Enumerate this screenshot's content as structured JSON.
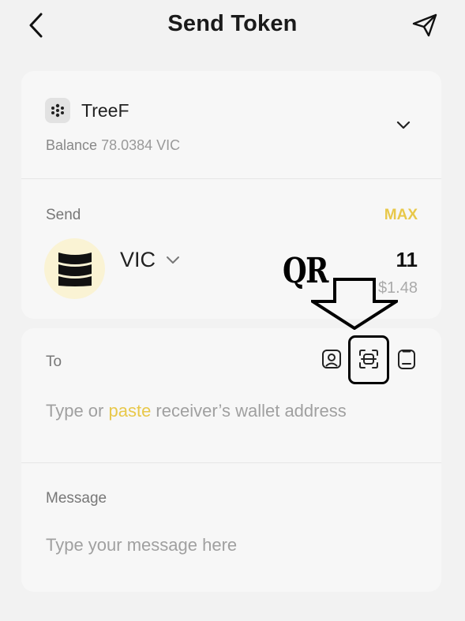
{
  "header": {
    "title": "Send Token",
    "back_icon": "chevron-left-icon",
    "action_icon": "paper-plane-icon"
  },
  "wallet": {
    "name": "TreeF",
    "balance_label": "Balance",
    "balance_value": "78.0384 VIC"
  },
  "send": {
    "label": "Send",
    "max_label": "MAX",
    "token_symbol": "VIC",
    "amount": "11",
    "amount_usd": "$1.48"
  },
  "recipient": {
    "label": "To",
    "placeholder_prefix": "Type or ",
    "placeholder_paste": "paste",
    "placeholder_suffix": " receiver’s wallet address"
  },
  "message": {
    "label": "Message",
    "placeholder": "Type your message here"
  },
  "annotation": {
    "text": "QR"
  },
  "colors": {
    "accent": "#e8c84a",
    "background": "#f2f2f2",
    "card": "#f7f7f7",
    "token_logo_bg": "#faf3d4"
  }
}
